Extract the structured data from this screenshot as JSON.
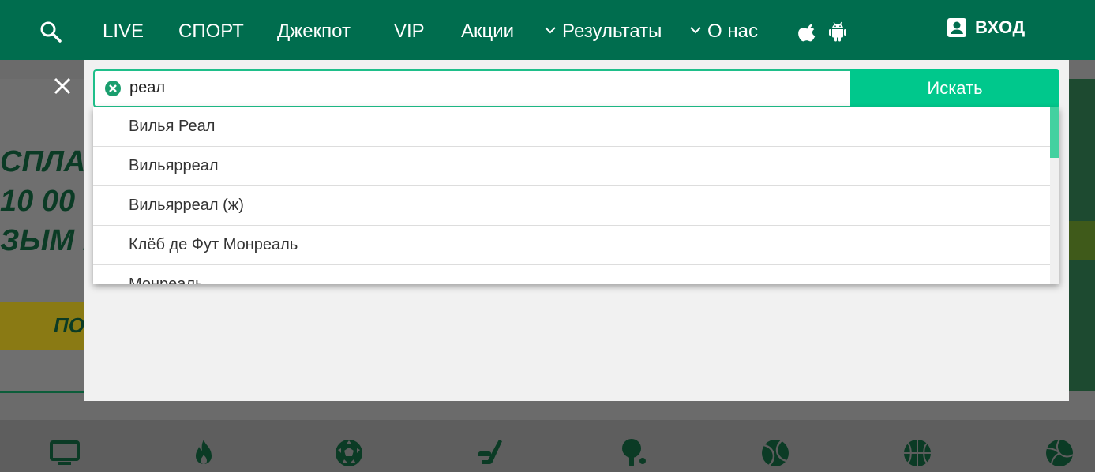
{
  "nav": {
    "items": [
      {
        "label": "LIVE"
      },
      {
        "label": "СПОРТ"
      },
      {
        "label": "Джекпот"
      },
      {
        "label": "VIP"
      },
      {
        "label": "Акции"
      },
      {
        "label": "Результаты"
      },
      {
        "label": "О нас"
      }
    ],
    "login_label": "ВХОД"
  },
  "search": {
    "value": "реал",
    "button_label": "Искать"
  },
  "suggestions": [
    "Вилья Реал",
    "Вильярреал",
    "Вильярреал (ж)",
    "Клёб де Фут Монреаль",
    "Монреаль"
  ],
  "background_banner": {
    "lines": [
      "СПЛАТ",
      "10 00",
      "ЗЫМ Г"
    ],
    "cta": "ПО"
  },
  "sports_icons": [
    "tv-icon",
    "fire-icon",
    "football-icon",
    "hockey-icon",
    "table-tennis-icon",
    "tennis-icon",
    "basketball-icon",
    "volleyball-icon"
  ],
  "colors": {
    "header_bg": "#006d4e",
    "accent": "#00c88c",
    "input_border": "#1fbf8a",
    "scroll_thumb": "#43d1a0"
  }
}
